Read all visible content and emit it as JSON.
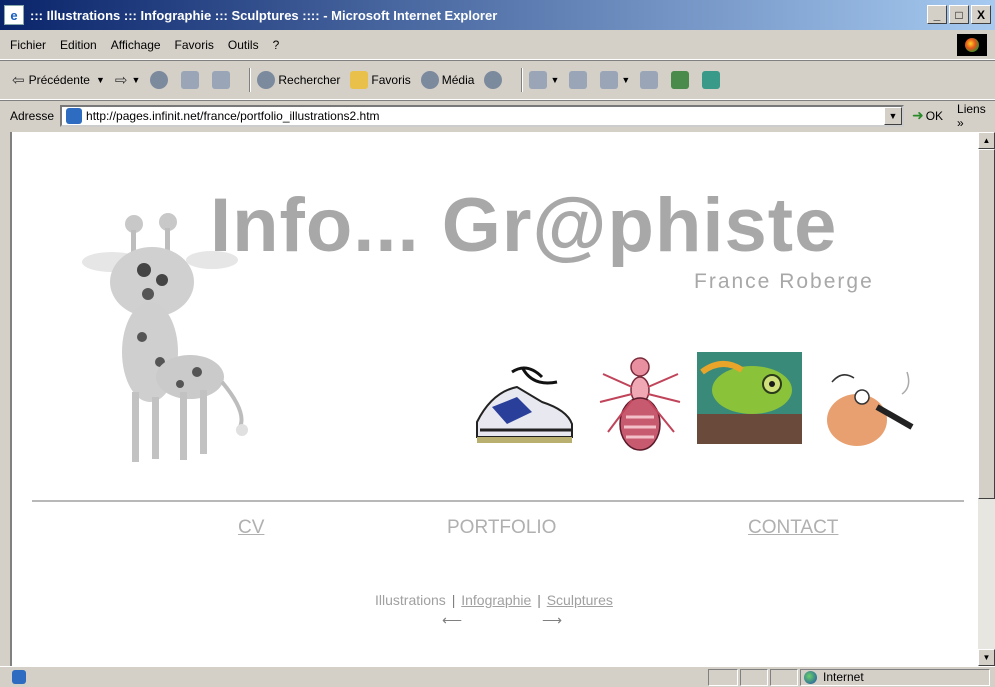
{
  "window": {
    "title": "::: Illustrations ::: Infographie ::: Sculptures :::: - Microsoft Internet Explorer",
    "minimize": "_",
    "maximize": "□",
    "close": "X"
  },
  "menu": {
    "items": [
      "Fichier",
      "Edition",
      "Affichage",
      "Favoris",
      "Outils",
      "?"
    ]
  },
  "toolbar": {
    "back_label": "Précédente",
    "search_label": "Rechercher",
    "favorites_label": "Favoris",
    "media_label": "Média"
  },
  "address": {
    "label": "Adresse",
    "url": "http://pages.infinit.net/france/portfolio_illustrations2.htm",
    "go_label": "OK",
    "links_label": "Liens »"
  },
  "page": {
    "title": "Info... Gr@phiste",
    "subtitle": "France Roberge",
    "nav": {
      "cv": "CV",
      "portfolio": "PORTFOLIO",
      "contact": "CONTACT"
    },
    "subnav": {
      "illustrations": "Illustrations",
      "separator": "|",
      "infographie": "Infographie",
      "sculptures": "Sculptures"
    },
    "arrow_left": "⟵",
    "arrow_right": "⟶"
  },
  "status": {
    "zone": "Internet"
  },
  "colors": {
    "titlebar_start": "#0a246a",
    "titlebar_end": "#a6caf0",
    "chrome": "#d4d0c8",
    "logo_gray": "#a8a8a8"
  }
}
